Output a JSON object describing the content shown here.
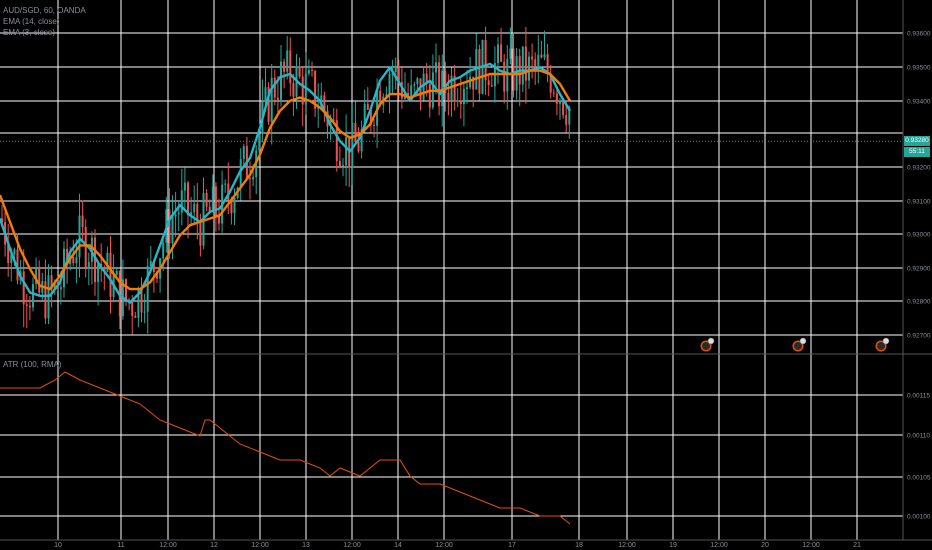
{
  "header": {
    "symbol_line": "AUD/SGD, 60, OANDA",
    "ema_fast_label": "EMA (14, close)",
    "ema_slow_label": "EMA (3, close)"
  },
  "atr_label": "ATR (100, RMA)",
  "last_price_badge": {
    "price": "0.93280",
    "countdown": "55:11"
  },
  "colors": {
    "background": "#000000",
    "grid": "#ffffff",
    "up_candle": "#26a69a",
    "down_candle": "#ef5350",
    "ema_fast": "#26b6c6",
    "ema_slow": "#f57c00",
    "atr_line": "#e65100",
    "axis_text": "#8a8e99"
  },
  "chart_data": [
    {
      "type": "candlestick",
      "title": "AUD/SGD, 60, OANDA",
      "x_ticks": [
        "10",
        "11",
        "12:00",
        "12",
        "12:00",
        "13",
        "12:00",
        "14",
        "12:00",
        "17",
        "18",
        "12:00",
        "19",
        "12:00",
        "20",
        "12:00",
        "21"
      ],
      "y_ticks": [
        "0.93600",
        "0.93500",
        "0.93400",
        "0.93200",
        "0.93100",
        "0.93000",
        "0.92900",
        "0.92800",
        "0.92700"
      ],
      "ylim": [
        0.9265,
        0.937
      ],
      "grid": true,
      "last_price": 0.9328,
      "series": [
        {
          "name": "EMA (14, close)",
          "x": [
            0,
            10,
            20,
            30,
            40,
            50,
            60,
            70,
            80,
            90,
            100,
            110,
            120,
            130,
            140,
            150,
            160,
            170,
            180,
            190,
            200,
            210,
            220,
            230,
            240,
            250,
            260,
            270,
            280,
            290,
            300,
            310,
            320,
            330,
            340,
            350,
            360,
            370,
            380,
            390,
            400,
            410,
            420,
            430,
            440,
            450,
            460,
            470,
            480,
            490,
            500,
            510,
            520,
            530,
            540,
            550,
            560,
            570
          ],
          "values": [
            0.9305,
            0.9296,
            0.9288,
            0.9283,
            0.9282,
            0.9282,
            0.9286,
            0.9295,
            0.9299,
            0.9296,
            0.9291,
            0.9287,
            0.9282,
            0.928,
            0.9283,
            0.9289,
            0.9297,
            0.9305,
            0.9309,
            0.9306,
            0.9304,
            0.9307,
            0.9308,
            0.9313,
            0.9319,
            0.9323,
            0.9332,
            0.9343,
            0.9347,
            0.9348,
            0.9345,
            0.9343,
            0.934,
            0.9333,
            0.9328,
            0.9325,
            0.9329,
            0.9337,
            0.9346,
            0.935,
            0.9345,
            0.934,
            0.9344,
            0.9346,
            0.9342,
            0.9346,
            0.9347,
            0.9349,
            0.935,
            0.9351,
            0.9349,
            0.9348,
            0.9349,
            0.9349,
            0.935,
            0.9348,
            0.9342,
            0.9337
          ]
        },
        {
          "name": "EMA (3, close)",
          "x": [
            0,
            10,
            20,
            30,
            40,
            50,
            60,
            70,
            80,
            90,
            100,
            110,
            120,
            130,
            140,
            150,
            160,
            170,
            180,
            190,
            200,
            210,
            220,
            230,
            240,
            250,
            260,
            270,
            280,
            290,
            300,
            310,
            320,
            330,
            340,
            350,
            360,
            370,
            380,
            390,
            400,
            410,
            420,
            430,
            440,
            450,
            460,
            470,
            480,
            490,
            500,
            510,
            520,
            530,
            540,
            550,
            560,
            570
          ],
          "values": [
            0.9312,
            0.9304,
            0.9296,
            0.929,
            0.9285,
            0.9284,
            0.9288,
            0.9293,
            0.9297,
            0.9297,
            0.9294,
            0.929,
            0.9286,
            0.9284,
            0.9284,
            0.9286,
            0.929,
            0.9295,
            0.93,
            0.9303,
            0.9304,
            0.9305,
            0.9306,
            0.931,
            0.9314,
            0.9318,
            0.9324,
            0.9332,
            0.9337,
            0.934,
            0.9341,
            0.934,
            0.9338,
            0.9335,
            0.9331,
            0.9329,
            0.933,
            0.9333,
            0.9339,
            0.9342,
            0.9342,
            0.9341,
            0.9342,
            0.9343,
            0.9343,
            0.9344,
            0.9345,
            0.9346,
            0.9347,
            0.9348,
            0.9348,
            0.9348,
            0.9348,
            0.9349,
            0.9349,
            0.9348,
            0.9345,
            0.934
          ]
        }
      ]
    },
    {
      "type": "line",
      "title": "ATR (100, RMA)",
      "y_ticks": [
        "0.00115",
        "0.00110",
        "0.00105",
        "0.00100"
      ],
      "ylim": [
        0.00098,
        0.0012
      ],
      "series": [
        {
          "name": "ATR (100, RMA)",
          "x": [
            0,
            20,
            40,
            55,
            65,
            80,
            100,
            120,
            140,
            160,
            180,
            200,
            205,
            210,
            220,
            240,
            260,
            280,
            300,
            320,
            330,
            340,
            360,
            380,
            400,
            410,
            420,
            440,
            460,
            480,
            500,
            520,
            540,
            560,
            570
          ],
          "values": [
            0.00116,
            0.00116,
            0.00116,
            0.00117,
            0.00118,
            0.00117,
            0.00116,
            0.00115,
            0.00114,
            0.00112,
            0.00111,
            0.0011,
            0.00112,
            0.00112,
            0.00111,
            0.00109,
            0.00108,
            0.00107,
            0.00107,
            0.00106,
            0.00105,
            0.00106,
            0.00105,
            0.00107,
            0.00107,
            0.00105,
            0.00104,
            0.00104,
            0.00103,
            0.00102,
            0.00101,
            0.00101,
            0.001,
            0.001,
            0.00099
          ]
        }
      ]
    }
  ]
}
